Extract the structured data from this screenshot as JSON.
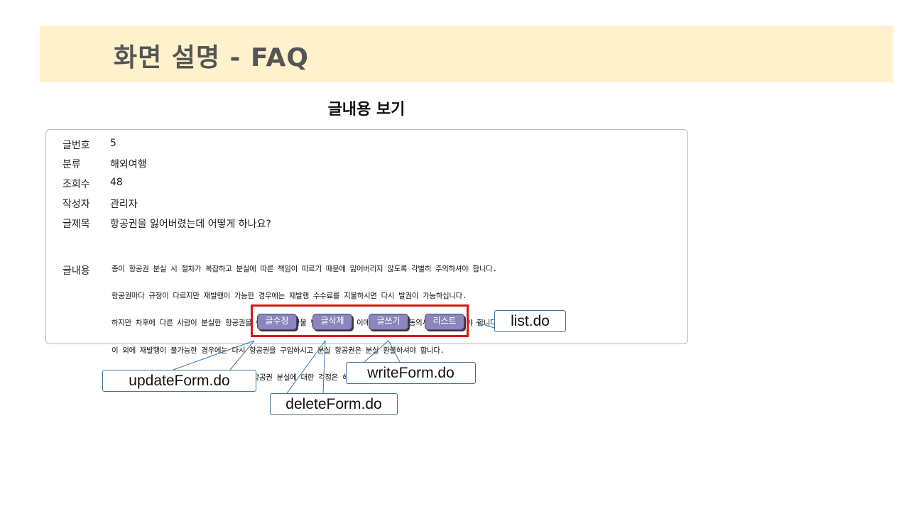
{
  "banner": {
    "title": "화면 설명 - FAQ"
  },
  "view": {
    "heading": "글내용 보기"
  },
  "fields": [
    {
      "label": "글번호",
      "value": "5"
    },
    {
      "label": "분류",
      "value": "해외여행"
    },
    {
      "label": "조회수",
      "value": "48"
    },
    {
      "label": "작성자",
      "value": "관리자"
    },
    {
      "label": "글제목",
      "value": "항공권을 잃어버렸는데 어떻게 하나요?"
    }
  ],
  "content": {
    "label": "글내용",
    "lines": [
      "종이 항공권 분실 시 절차가 복잡하고 분실에 따른 책임이 따르기 때문에 잃어버리지 않도록 각별히 주의하셔야 합니다.",
      "항공권마다 규정이 다르지만 재발행이 가능한 경우에는 재발행 수수료를 지불하시면 다시 발권이 가능하십니다.",
      "하지만 차후에 다른 사람이 분실한 항공권을 이용하거나 환불 받을 수 있어 이에 대한 배상 동의서를 작성하셔야 합니다.",
      "이 외에 재발행이 불가능한 경우에는 다시 항공권을 구입하시고 분실 항공권은 분실 환불하셔야 합니다.",
      "단 전자항공권(e-ticket)을 발권하셨다면 항공권 분실에 대한 걱정은 하지 않으셔도 됩니다."
    ]
  },
  "buttons": {
    "update": "글수정",
    "delete": "글삭제",
    "write": "글쓰기",
    "list": "리스트"
  },
  "callouts": {
    "list": "list.do",
    "update": "updateForm.do",
    "delete": "deleteForm.do",
    "write": "writeForm.do"
  },
  "colors": {
    "banner": "#fff1cc",
    "button": "#8b86bd",
    "highlight_border": "#d81818",
    "callout_border": "#41719c"
  }
}
